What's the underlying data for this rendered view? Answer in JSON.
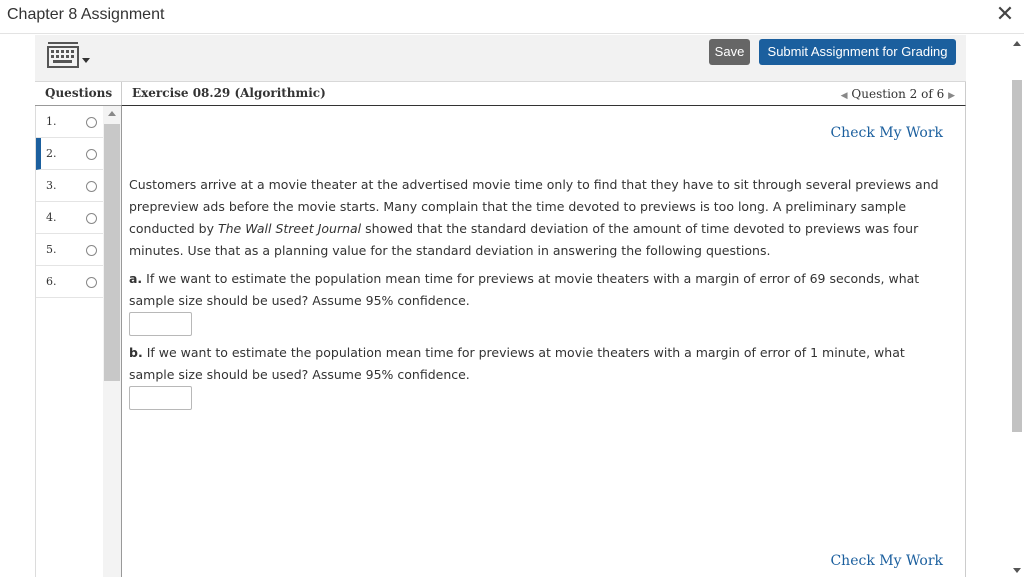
{
  "window": {
    "title": "Chapter 8 Assignment",
    "close_glyph": "✕"
  },
  "toolbar": {
    "keyboard_icon": "keyboard-icon",
    "save_label": "Save",
    "submit_label": "Submit Assignment for Grading"
  },
  "questions": {
    "header": "Questions",
    "items": [
      {
        "number": "1."
      },
      {
        "number": "2.",
        "active": true
      },
      {
        "number": "3."
      },
      {
        "number": "4."
      },
      {
        "number": "5."
      },
      {
        "number": "6."
      }
    ]
  },
  "exercise": {
    "title": "Exercise 08.29 (Algorithmic)",
    "nav_text": "Question 2 of 6",
    "check_my_work": "Check My Work",
    "problem_pre": "Customers arrive at a movie theater at the advertised movie time only to find that they have to sit through several previews and prepreview ads before the movie starts. Many complain that the time devoted to previews is too long. A preliminary sample conducted by ",
    "problem_journal": "The Wall Street Journal",
    "problem_post": " showed that the standard deviation of the amount of time devoted to previews was four minutes. Use that as a planning value for the standard deviation in answering the following questions.",
    "parts": [
      {
        "letter": "a.",
        "text": "If we want to estimate the population mean time for previews at movie theaters with a margin of error of 69 seconds, what sample size should be used? Assume 95% confidence.",
        "value": ""
      },
      {
        "letter": "b.",
        "text": "If we want to estimate the population mean time for previews at movie theaters with a margin of error of 1 minute, what sample size should be used? Assume 95% confidence.",
        "value": ""
      }
    ]
  },
  "colors": {
    "accent": "#1b5f9e",
    "save_button": "#666666",
    "active_marker": "#1b5f9e"
  }
}
